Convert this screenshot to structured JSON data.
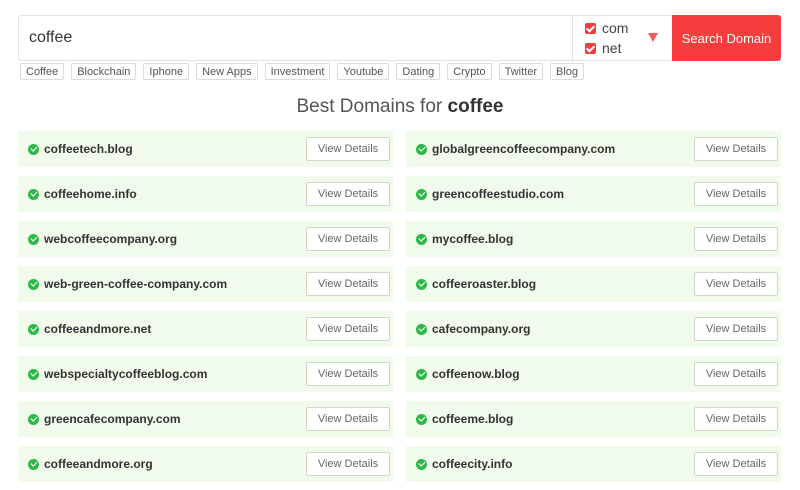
{
  "search": {
    "value": "coffee",
    "button_label": "Search Domain",
    "tlds": [
      {
        "label": "com",
        "checked": true
      },
      {
        "label": "net",
        "checked": true
      }
    ]
  },
  "tags": [
    "Coffee",
    "Blockchain",
    "Iphone",
    "New Apps",
    "Investment",
    "Youtube",
    "Dating",
    "Crypto",
    "Twitter",
    "Blog"
  ],
  "heading": {
    "prefix": "Best Domains for",
    "keyword": "coffee"
  },
  "details_label": "View Details",
  "domains": [
    "coffeetech.blog",
    "globalgreencoffeecompany.com",
    "coffeehome.info",
    "greencoffeestudio.com",
    "webcoffeecompany.org",
    "mycoffee.blog",
    "web-green-coffee-company.com",
    "coffeeroaster.blog",
    "coffeeandmore.net",
    "cafecompany.org",
    "webspecialtycoffeeblog.com",
    "coffeenow.blog",
    "greencafecompany.com",
    "coffeeme.blog",
    "coffeeandmore.org",
    "coffeecity.info"
  ],
  "colors": {
    "accent": "#f53d3d",
    "available": "#2fb84a",
    "row_bg": "#f1fbec"
  }
}
